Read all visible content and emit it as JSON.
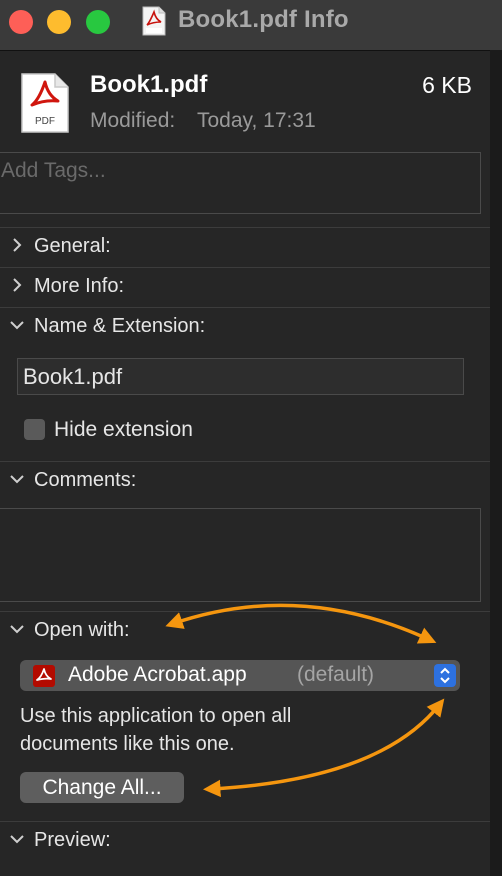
{
  "window": {
    "title": "Book1.pdf Info"
  },
  "header": {
    "file_name": "Book1.pdf",
    "file_size": "6 KB",
    "modified_label": "Modified:",
    "modified_value": "Today, 17:31",
    "file_icon_text": "PDF"
  },
  "tags": {
    "placeholder": "Add Tags..."
  },
  "sections": {
    "general": "General:",
    "more_info": "More Info:",
    "name_extension": "Name & Extension:",
    "comments": "Comments:",
    "open_with": "Open with:",
    "preview": "Preview:"
  },
  "name_extension": {
    "value": "Book1.pdf",
    "hide_extension_label": "Hide extension",
    "hide_extension_checked": false
  },
  "open_with": {
    "app_name": "Adobe Acrobat.app",
    "app_default": "(default)",
    "help_text": "Use this application to open all documents like this one.",
    "change_all_label": "Change All..."
  },
  "colors": {
    "background": "#262626",
    "annotation_arrow": "#f5960f",
    "popup_accent": "#2d71e0",
    "pdf_red": "#b30b00"
  },
  "icons": [
    "pdf-document-icon",
    "chevron-right-icon",
    "chevron-down-icon",
    "acrobat-app-icon",
    "popup-arrows-icon"
  ]
}
